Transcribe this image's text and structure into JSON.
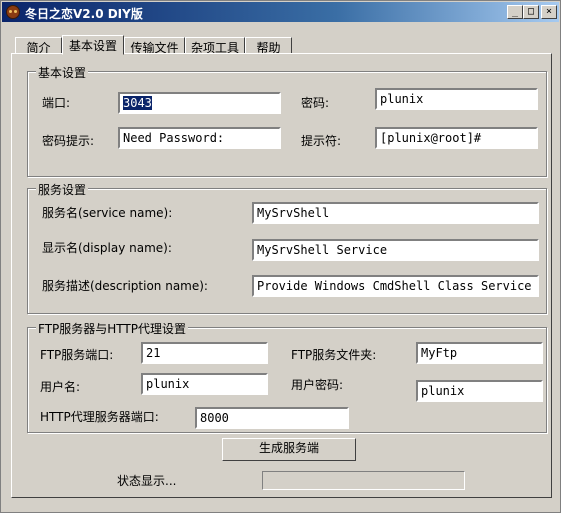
{
  "window": {
    "title": "冬日之恋V2.0 DIY版",
    "minimize_glyph": "_",
    "maximize_glyph": "□",
    "close_glyph": "×"
  },
  "tabs": [
    {
      "label": "简介"
    },
    {
      "label": "基本设置",
      "active": true
    },
    {
      "label": "传输文件"
    },
    {
      "label": "杂项工具"
    },
    {
      "label": "帮助"
    }
  ],
  "basic": {
    "title": "基本设置",
    "port_label": "端口:",
    "port_value": "3043",
    "password_label": "密码:",
    "password_value": "plunix",
    "hint_label": "密码提示:",
    "hint_value": "Need Password:",
    "prompt_label": "提示符:",
    "prompt_value": "[plunix@root]#"
  },
  "service": {
    "title": "服务设置",
    "name_label": "服务名(service name):",
    "name_value": "MySrvShell",
    "display_label": "显示名(display name):",
    "display_value": "MySrvShell Service",
    "desc_label": "服务描述(description name):",
    "desc_value": "Provide Windows CmdShell Class Service"
  },
  "ftp": {
    "title": "FTP服务器与HTTP代理设置",
    "port_label": "FTP服务端口:",
    "port_value": "21",
    "folder_label": "FTP服务文件夹:",
    "folder_value": "MyFtp",
    "user_label": "用户名:",
    "user_value": "plunix",
    "pass_label": "用户密码:",
    "pass_value": "plunix",
    "http_port_label": "HTTP代理服务器端口:",
    "http_port_value": "8000"
  },
  "actions": {
    "generate_label": "生成服务端",
    "status_label": "状态显示...",
    "status_value": ""
  }
}
